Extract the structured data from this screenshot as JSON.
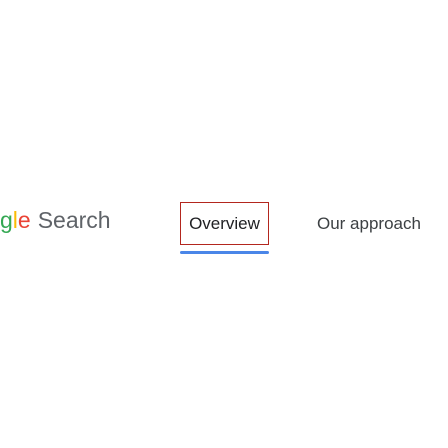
{
  "header": {
    "logo_fragment": "gle",
    "product_name": "Search",
    "logo_colors": {
      "g": "#34a853",
      "l": "#fbbc05",
      "e": "#ea4335"
    }
  },
  "nav": {
    "tabs": [
      {
        "label": "Overview",
        "active": true
      },
      {
        "label": "Our approach",
        "active": false
      }
    ],
    "active_underline_color": "#4a86e8",
    "focus_outline_color": "#b3261e"
  }
}
